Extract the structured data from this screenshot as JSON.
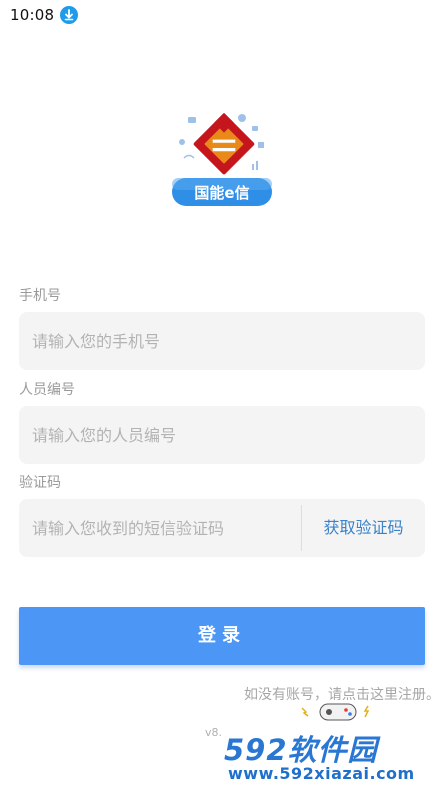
{
  "status_bar": {
    "time": "10:08"
  },
  "logo": {
    "text": "国能e信",
    "colors": {
      "red": "#c4161c",
      "orange": "#e8891a",
      "banner": "#2f8fe6"
    }
  },
  "form": {
    "phone": {
      "label": "手机号",
      "placeholder": "请输入您的手机号",
      "value": ""
    },
    "staff_id": {
      "label": "人员编号",
      "placeholder": "请输入您的人员编号",
      "value": ""
    },
    "code": {
      "label": "验证码",
      "placeholder": "请输入您收到的短信验证码",
      "value": "",
      "button_label": "获取验证码"
    }
  },
  "login_button_label": "登录",
  "register_link": "如没有账号，请点击这里注册。",
  "version_text": "v8.",
  "watermark": {
    "brand": "592软件园",
    "url": "www.592xiazai.com"
  },
  "colors": {
    "accent": "#4c96f6",
    "link": "#3b82c9",
    "field_bg": "#f4f4f5"
  }
}
